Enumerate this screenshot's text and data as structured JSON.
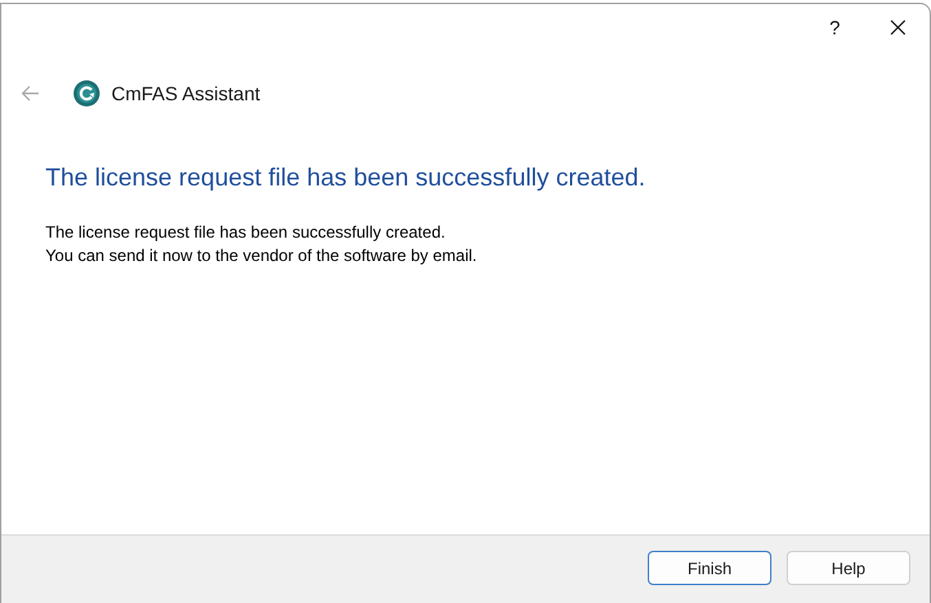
{
  "title_bar": {
    "help_button": "?"
  },
  "header": {
    "back_button": {
      "disabled": true
    },
    "app_name": "CmFAS Assistant"
  },
  "heading": "The license request file has been successfully created.",
  "message_lines": [
    "The license request file has been successfully created.",
    "You can send it now to the vendor of the software by email."
  ],
  "buttons": [
    {
      "label": "Finish",
      "default": true
    },
    {
      "label": "Help",
      "default": false
    }
  ]
}
